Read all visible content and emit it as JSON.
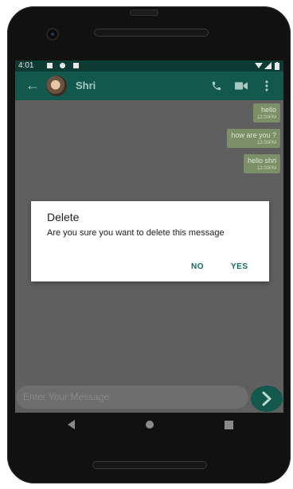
{
  "status_bar": {
    "time": "4:01"
  },
  "app_bar": {
    "back_symbol": "←",
    "contact_name": "Shri"
  },
  "messages": [
    {
      "text": "hello",
      "time": "12:00PM"
    },
    {
      "text": "how are you ?",
      "time": "12:00PM"
    },
    {
      "text": "hello shri",
      "time": "12:00PM"
    }
  ],
  "dialog": {
    "title": "Delete",
    "message": "Are you sure you want to delete this message",
    "negative_label": "NO",
    "positive_label": "YES"
  },
  "composer": {
    "placeholder": "Enter Your Message",
    "send_symbol": ">"
  },
  "colors": {
    "app_bar": "#12584c",
    "status_bar": "#0b3b33",
    "bubble": "#7c8f67",
    "accent": "#0f6b5f"
  },
  "icons": [
    "back-arrow-icon",
    "phone-icon",
    "video-icon",
    "more-icon",
    "send-icon",
    "nav-back-icon",
    "nav-home-icon",
    "nav-recents-icon",
    "wifi-icon",
    "signal-icon",
    "battery-icon"
  ]
}
